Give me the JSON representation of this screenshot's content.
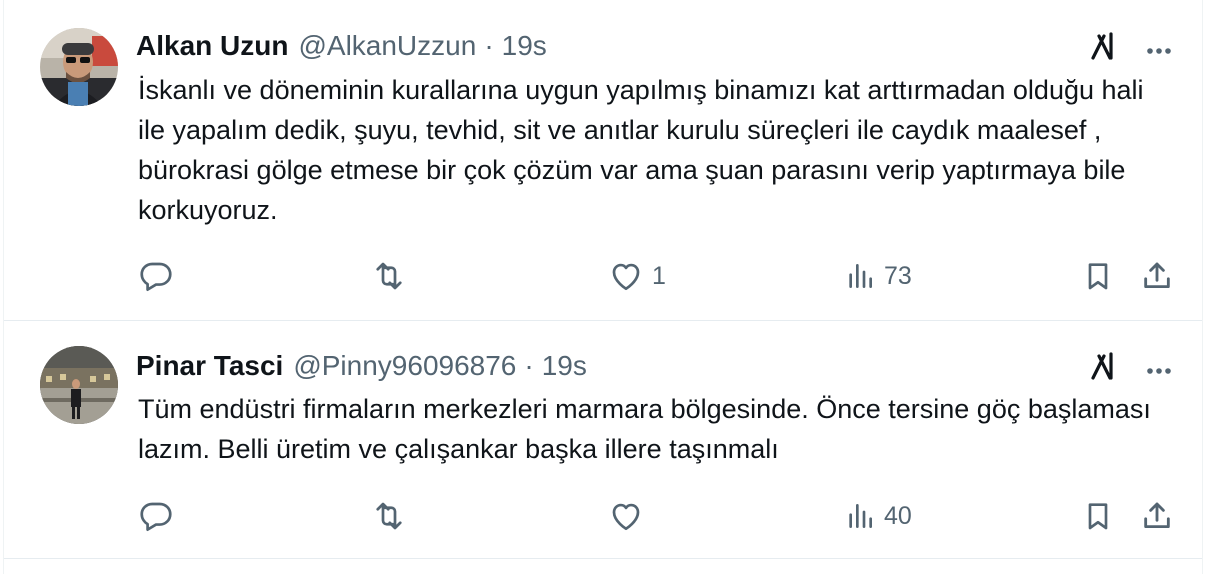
{
  "tweets": [
    {
      "name": "Alkan Uzun",
      "handle": "@AlkanUzzun",
      "separator": "·",
      "time": "19s",
      "text": "İskanlı ve döneminin kurallarına uygun yapılmış binamızı kat arttırmadan olduğu hali ile yapalım dedik, şuyu, tevhid, sit ve anıtlar kurulu süreçleri ile caydık maalesef , bürokrasi gölge etmese bir çok çözüm var ama şuan parasını verip yaptırmaya bile korkuyoruz.",
      "likes": "1",
      "views": "73"
    },
    {
      "name": "Pinar Tasci",
      "handle": "@Pinny96096876",
      "separator": "·",
      "time": "19s",
      "text": "Tüm endüstri firmaların merkezleri marmara bölgesinde. Önce tersine göç başlaması lazım. Belli üretim ve çalışankar başka illere taşınmalı",
      "likes": "",
      "views": "40"
    }
  ],
  "icons": {
    "reply": "reply-icon",
    "retweet": "retweet-icon",
    "like": "heart-icon",
    "views": "analytics-icon",
    "bookmark": "bookmark-icon",
    "share": "share-icon",
    "grok": "grok-icon",
    "more": "more-icon"
  },
  "colors": {
    "text": "#0f1419",
    "secondary": "#536471",
    "divider": "#eff3f4"
  }
}
